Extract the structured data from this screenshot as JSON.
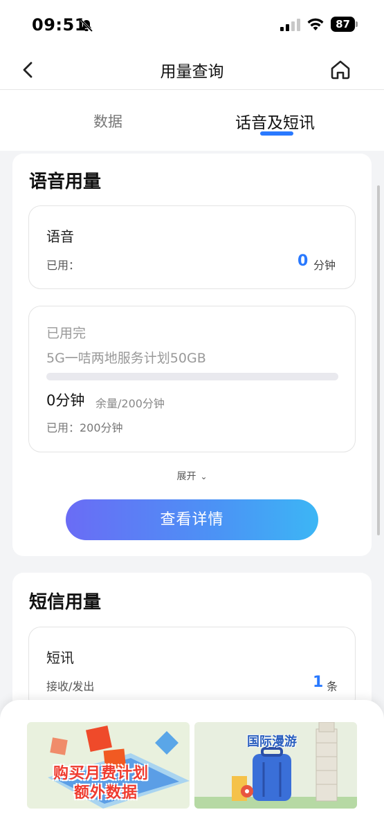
{
  "status_bar": {
    "time": "09:51",
    "battery": "87",
    "icons": [
      "bell-muted-icon",
      "signal-icon",
      "wifi-icon",
      "battery-icon"
    ]
  },
  "nav": {
    "title": "用量查询",
    "back_icon": "chevron-left-icon",
    "home_icon": "home-icon"
  },
  "tabs": [
    {
      "label": "数据",
      "active": false
    },
    {
      "label": "话音及短讯",
      "active": true
    }
  ],
  "voice_usage": {
    "title": "语音用量",
    "summary": {
      "label": "语音",
      "used_label": "已用：",
      "value": "0",
      "unit": "分钟"
    },
    "plan": {
      "status": "已用完",
      "name": "5G一咭两地服务计划50GB",
      "progress_fraction": 0,
      "remaining_main": "0分钟",
      "remaining_detail": "余量/200分钟",
      "used_text": "已用：200分钟"
    },
    "expand_label": "展开",
    "detail_button": "查看详情"
  },
  "sms_usage": {
    "title": "短信用量",
    "summary": {
      "label": "短讯",
      "used_label": "接收/发出",
      "value": "1",
      "unit": "条"
    }
  },
  "banners": [
    {
      "line1": "购买月费计划",
      "line2": "额外数据"
    },
    {
      "title": "国际漫游"
    }
  ],
  "colors": {
    "accent": "#2979ff",
    "button_start": "#6a6cf5",
    "button_end": "#3cb6f5",
    "banner_red": "#ef3b2f"
  }
}
